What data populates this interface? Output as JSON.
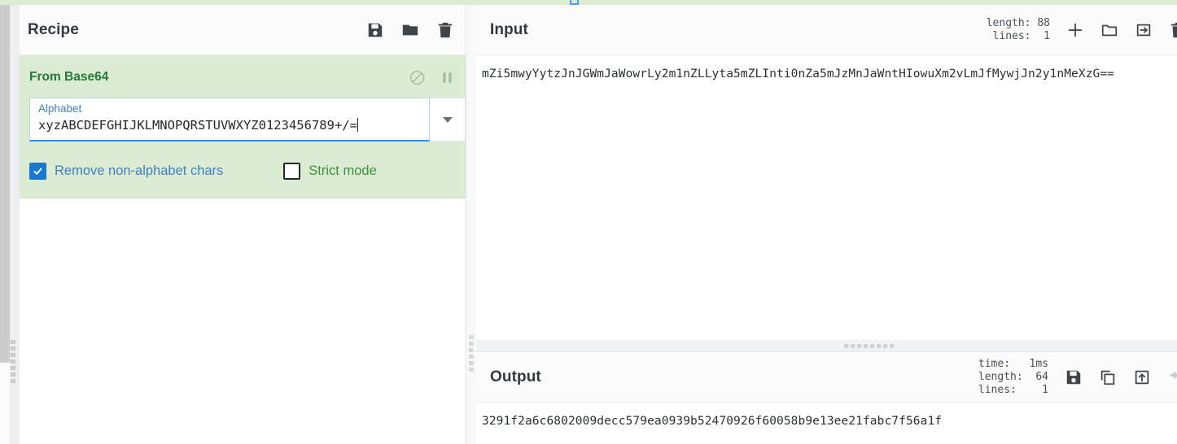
{
  "recipe": {
    "title": "Recipe",
    "header_icons": [
      {
        "name": "save-recipe-icon",
        "glyph": "floppy"
      },
      {
        "name": "load-recipe-icon",
        "glyph": "folder"
      },
      {
        "name": "clear-recipe-icon",
        "glyph": "trash"
      }
    ],
    "operation": {
      "name": "From Base64",
      "controls": [
        {
          "name": "disable-operation-icon",
          "glyph": "ban"
        },
        {
          "name": "set-breakpoint-icon",
          "glyph": "pause"
        }
      ],
      "alphabet_field": {
        "label": "Alphabet",
        "value": "xyzABCDEFGHIJKLMNOPQRSTUVWXYZ0123456789+/=",
        "dropdown_icon": "chevron-down-icon"
      },
      "checkboxes": [
        {
          "label": "Remove non-alphabet chars",
          "checked": true,
          "color": "#3f7fbf"
        },
        {
          "label": "Strict mode",
          "checked": false,
          "color": "#3f8f3f"
        }
      ]
    }
  },
  "input": {
    "title": "Input",
    "stats": "length: 88\nlines:  1",
    "length": "88",
    "lines": "1",
    "text": "mZi5mwyYytzJnJGWmJaWowrLy2m1nZLLyta5mZLInti0nZa5mJzMnJaWntHIowuXm2vLmJfMywjJn2y1nMeXzG==",
    "icons": [
      {
        "name": "add-input-tab-icon",
        "glyph": "plus"
      },
      {
        "name": "open-file-as-input-icon",
        "glyph": "folder-open"
      },
      {
        "name": "open-folder-as-input-icon",
        "glyph": "import"
      },
      {
        "name": "clear-io-icon",
        "glyph": "trash"
      }
    ]
  },
  "output": {
    "title": "Output",
    "stats": "time:   1ms\nlength:  64\nlines:    1",
    "time": "1ms",
    "length": "64",
    "lines": "1",
    "text": "3291f2a6c6802009decc579ea0939b52470926f60058b9e13ee21fabc7f56a1f",
    "icons": [
      {
        "name": "save-output-icon",
        "glyph": "floppy"
      },
      {
        "name": "copy-output-icon",
        "glyph": "copy"
      },
      {
        "name": "replace-input-with-output-icon",
        "glyph": "export"
      },
      {
        "name": "undo-bake-icon",
        "glyph": "undo"
      }
    ]
  },
  "colors": {
    "operation_bg": "#dcecd2",
    "operation_title": "#26773b",
    "accent_blue": "#1878d2",
    "panel_header_bg": "#fbfbfb"
  }
}
